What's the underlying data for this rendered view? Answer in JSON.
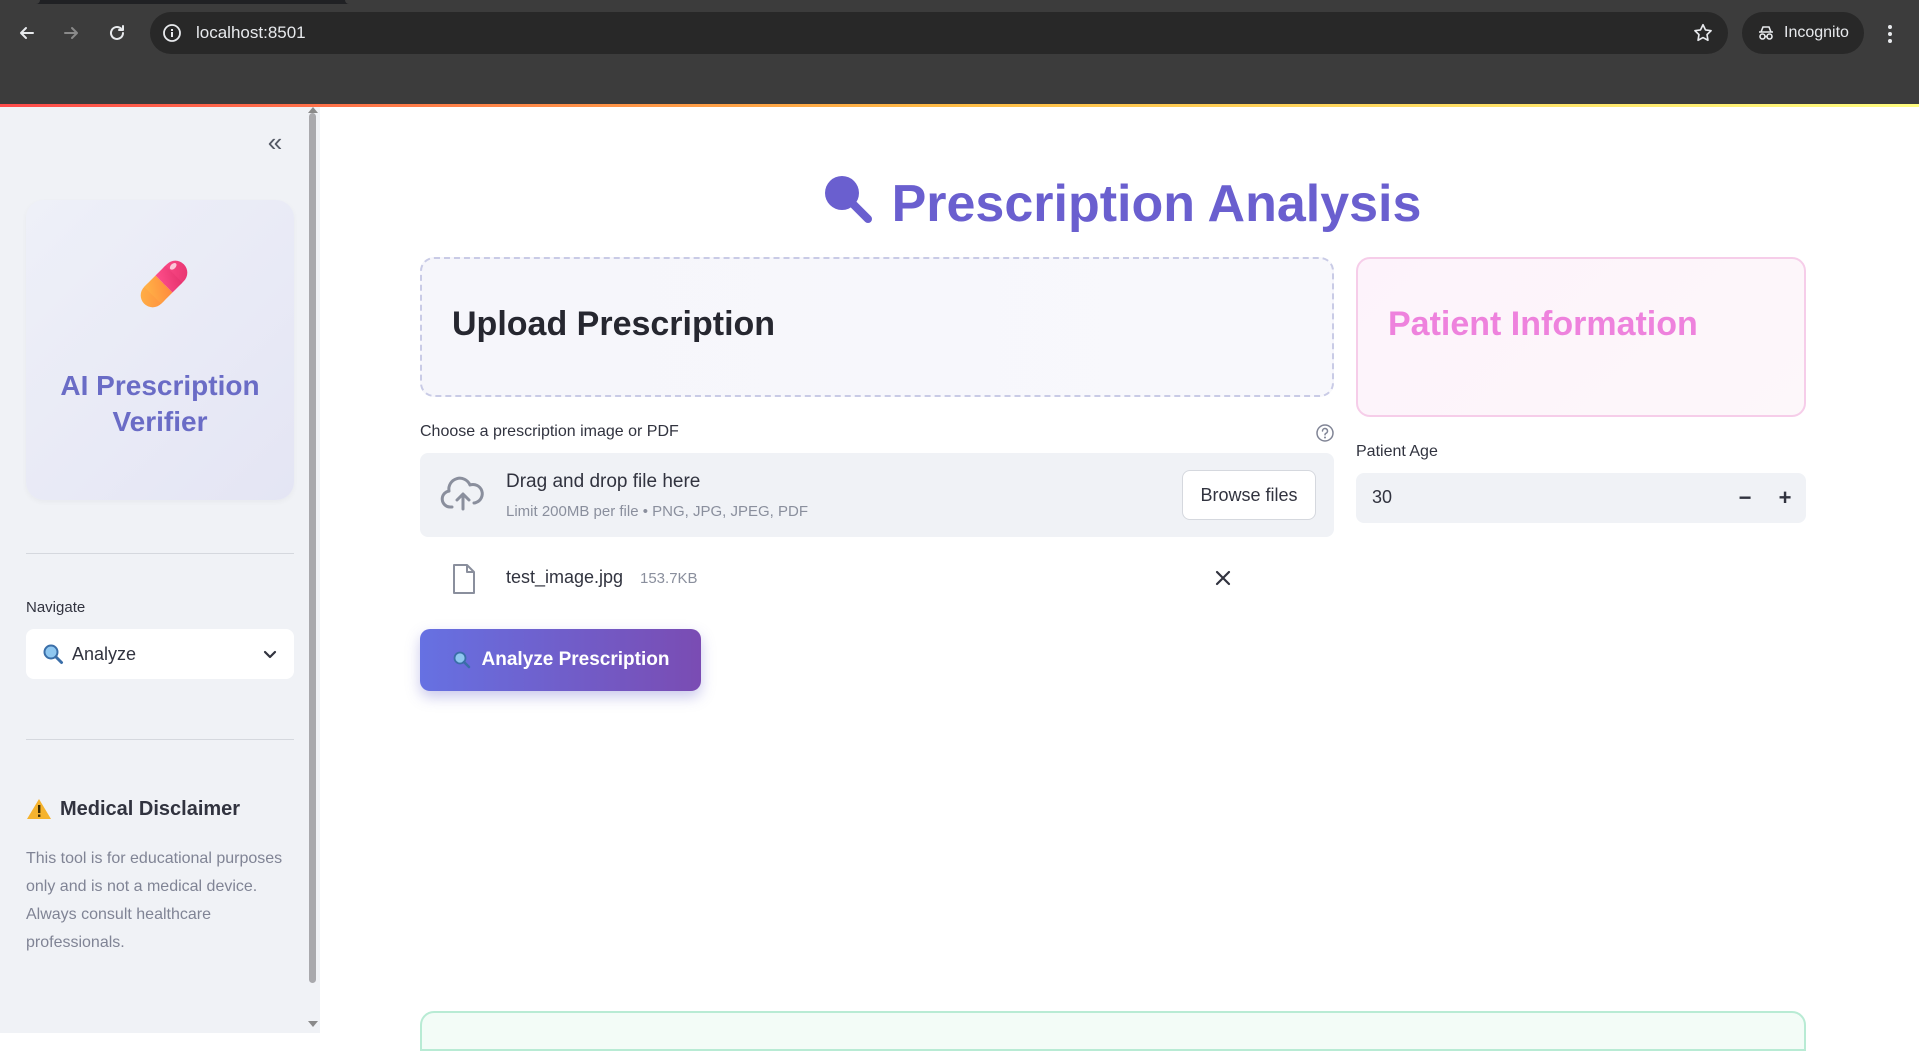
{
  "browser": {
    "url": "localhost:8501",
    "incognito_label": "Incognito",
    "icons": [
      "back-arrow-icon",
      "forward-arrow-icon",
      "reload-icon",
      "info-icon",
      "star-icon",
      "incognito-icon",
      "kebab-menu-icon"
    ]
  },
  "sidebar": {
    "collapse_icon": "double-chevron-left-icon",
    "brand": {
      "icon": "pill-icon",
      "title": "AI Prescription Verifier"
    },
    "navigate": {
      "label": "Navigate",
      "selected": "Analyze",
      "selected_icon": "magnifier-icon"
    },
    "disclaimer": {
      "icon": "warning-icon",
      "title": "Medical Disclaimer",
      "text": "This tool is for educational purposes only and is not a medical device. Always consult healthcare professionals."
    }
  },
  "main": {
    "title": "Prescription Analysis",
    "title_icon": "magnifier-icon",
    "upload_card_title": "Upload Prescription",
    "patient_card_title": "Patient Information",
    "uploader": {
      "label": "Choose a prescription image or PDF",
      "drop_title": "Drag and drop file here",
      "limit": "Limit 200MB per file • PNG, JPG, JPEG, PDF",
      "browse_label": "Browse files"
    },
    "file": {
      "name": "test_image.jpg",
      "size": "153.7KB"
    },
    "analyze_button": "Analyze Prescription",
    "patient_age": {
      "label": "Patient Age",
      "value": "30",
      "decrement": "−",
      "increment": "+"
    }
  },
  "colors": {
    "accent": "#6a5fcf",
    "brand_title": "#6a6cc6",
    "patient_title": "#ee82dd",
    "button_gradient_start": "#6671e2",
    "button_gradient_end": "#7a4cb3"
  }
}
